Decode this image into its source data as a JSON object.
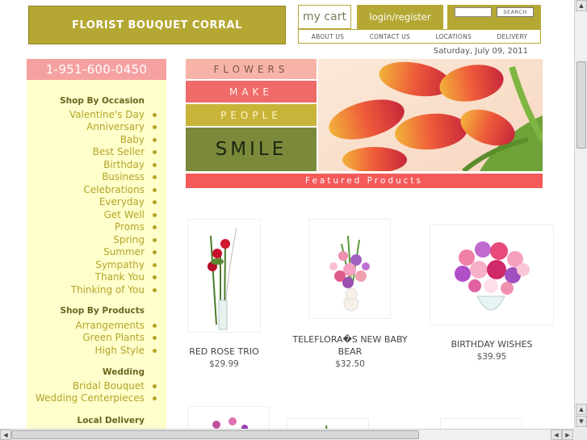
{
  "header": {
    "brand": "FLORIST BOUQUET CORRAL",
    "cart_label": "my cart",
    "login_label": "login/register",
    "search_button": "SEARCH",
    "search_value": "",
    "nav": [
      "ABOUT US",
      "CONTACT US",
      "LOCATIONS",
      "DELIVERY"
    ],
    "date": "Saturday, July 09, 2011"
  },
  "sidebar": {
    "phone": "1-951-600-0450",
    "sections": [
      {
        "heading": "Shop By Occasion",
        "items": [
          "Valentine's Day",
          "Anniversary",
          "Baby",
          "Best Seller",
          "Birthday",
          "Business",
          "Celebrations",
          "Everyday",
          "Get Well",
          "Proms",
          "Spring",
          "Summer",
          "Sympathy",
          "Thank You",
          "Thinking of You"
        ]
      },
      {
        "heading": "Shop By Products",
        "items": [
          "Arrangements",
          "Green Plants",
          "High Style"
        ]
      },
      {
        "heading": "Wedding",
        "items": [
          "Bridal Bouquet",
          "Wedding Centerpieces"
        ]
      },
      {
        "heading": "Local Delivery",
        "items": []
      }
    ]
  },
  "banner": {
    "words": [
      "FLOWERS",
      "MAKE",
      "PEOPLE",
      "SMILE"
    ],
    "featured_label": "Featured Products"
  },
  "products": [
    {
      "name": "RED ROSE TRIO",
      "price": "$29.99"
    },
    {
      "name": "TELEFLORA�S NEW BABY BEAR",
      "price": "$32.50"
    },
    {
      "name": "BIRTHDAY WISHES",
      "price": "$39.95"
    }
  ],
  "colors": {
    "olive": "#b5a733",
    "pink": "#f6a1a1",
    "coral": "#f45a5a",
    "cream": "#ffffcc"
  }
}
